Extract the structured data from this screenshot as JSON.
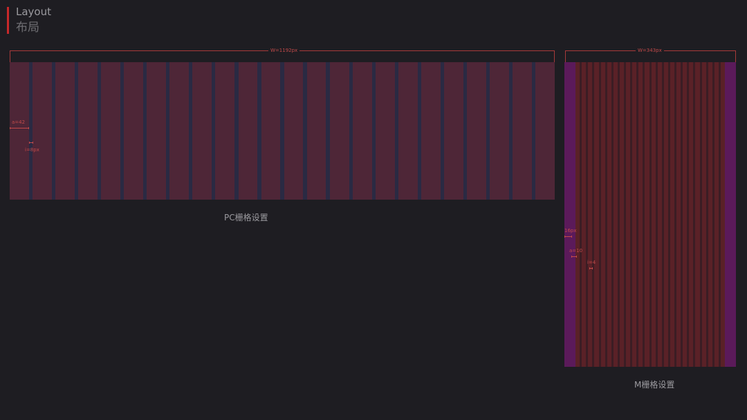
{
  "header": {
    "title_en": "Layout",
    "title_cn": "布局"
  },
  "pc_grid": {
    "width_label": "W=1192px",
    "column_count": 24,
    "column_label": "a=42",
    "gutter_label": "i=8px",
    "caption": "PC栅格设置"
  },
  "mobile_grid": {
    "width_label": "W=343px",
    "column_count": 24,
    "margin_label": "16px",
    "column_label": "a=10",
    "gutter_label": "i=4",
    "caption": "M栅格设置"
  },
  "colors": {
    "accent": "#c8282a",
    "pc_column": "#4e2637",
    "pc_gutter": "#2a2a43",
    "m_column": "#5a2127",
    "m_margin": "#5b1a5a",
    "annotation": "#c24a4a"
  }
}
